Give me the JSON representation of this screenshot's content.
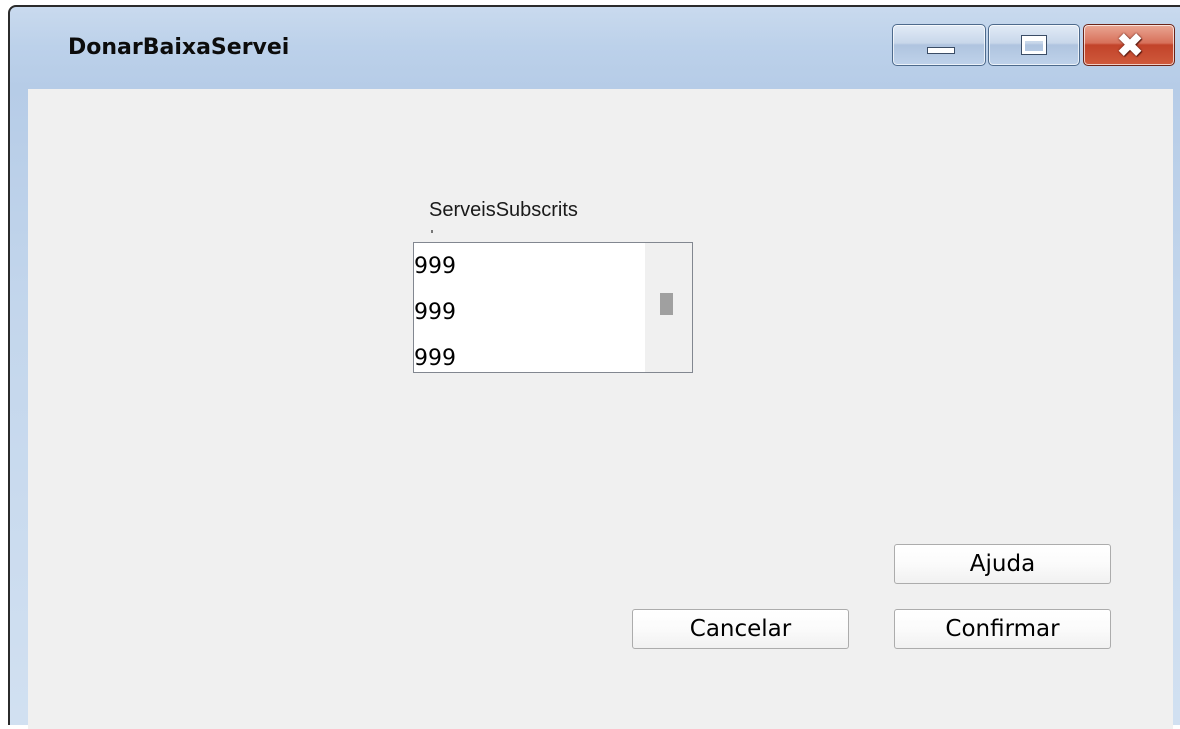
{
  "window": {
    "title": "DonarBaixaServei"
  },
  "titlebar_buttons": {
    "minimize_icon": "minimize-icon",
    "maximize_icon": "maximize-icon",
    "close_icon": "close-icon",
    "close_glyph": "✖"
  },
  "list": {
    "label": "ServeisSubscrits",
    "items": [
      "999",
      "999",
      "999"
    ]
  },
  "buttons": {
    "help_label": "Ajuda",
    "cancel_label": "Cancelar",
    "confirm_label": "Confirmar"
  }
}
